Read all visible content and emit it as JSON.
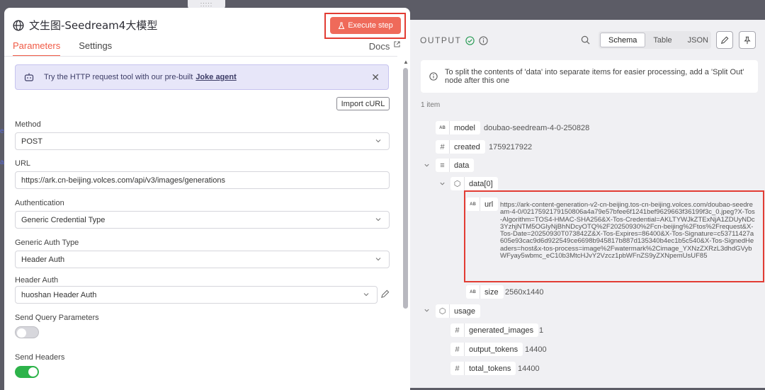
{
  "node": {
    "title": "文生图-Seedream4大模型",
    "execute_label": "Execute step"
  },
  "tabs": [
    "Parameters",
    "Settings"
  ],
  "docs_label": "Docs",
  "notice": {
    "text": "Try the HTTP request tool with our pre-built",
    "link": "Joke agent"
  },
  "import_label": "Import cURL",
  "fields": {
    "method": {
      "label": "Method",
      "value": "POST"
    },
    "url": {
      "label": "URL",
      "value": "https://ark.cn-beijing.volces.com/api/v3/images/generations"
    },
    "authentication": {
      "label": "Authentication",
      "value": "Generic Credential Type"
    },
    "generic_auth_type": {
      "label": "Generic Auth Type",
      "value": "Header Auth"
    },
    "header_auth": {
      "label": "Header Auth",
      "value": "huoshan Header Auth"
    },
    "send_query": {
      "label": "Send Query Parameters",
      "enabled": false
    },
    "send_headers": {
      "label": "Send Headers",
      "enabled": true
    }
  },
  "output": {
    "title": "OUTPUT",
    "views": [
      "Schema",
      "Table",
      "JSON"
    ],
    "active_view": "Schema",
    "info": "To split the contents of 'data' into separate items for easier processing, add a 'Split Out' node after this one",
    "item_count": "1 item",
    "model_key": "model",
    "model_value": "doubao-seedream-4-0-250828",
    "created_key": "created",
    "created_value": "1759217922",
    "data_key": "data",
    "data0_key": "data[0]",
    "url_key": "url",
    "url_value": "https://ark-content-generation-v2-cn-beijing.tos-cn-beijing.volces.com/doubao-seedream-4-0/0217592179150806a4a79e57bfee6f1241bef9629663f36199f3c_0.jpeg?X-Tos-Algorithm=TOS4-HMAC-SHA256&X-Tos-Credential=AKLTYWJkZTExNjA1ZDUyNDc3YzhjNTM5OGIyNjBhNDcyOTQ%2F20250930%2Fcn-beijing%2Ftos%2Frequest&X-Tos-Date=20250930T073842Z&X-Tos-Expires=86400&X-Tos-Signature=c53711427a605e93cac9d6d922549ce6698b945817b887d135340b4ec1b5c540&X-Tos-SignedHeaders=host&x-tos-process=image%2Fwatermark%2Cimage_YXNzZXRzL3dhdGVybWFyay5wbmc_eC10b3MtcHJvY2Vzcz1pbWFnZS9yZXNpemUsUF85",
    "size_key": "size",
    "size_value": "2560x1440",
    "usage_key": "usage",
    "generated_images_key": "generated_images",
    "generated_images_value": "1",
    "output_tokens_key": "output_tokens",
    "output_tokens_value": "14400",
    "total_tokens_key": "total_tokens",
    "total_tokens_value": "14400"
  },
  "colors": {
    "accent": "#f05a45",
    "execute_bg": "#ef6a5a",
    "highlight": "#e23c33",
    "toggle_on": "#2db34a",
    "notice_bg": "#e7e6f9"
  }
}
